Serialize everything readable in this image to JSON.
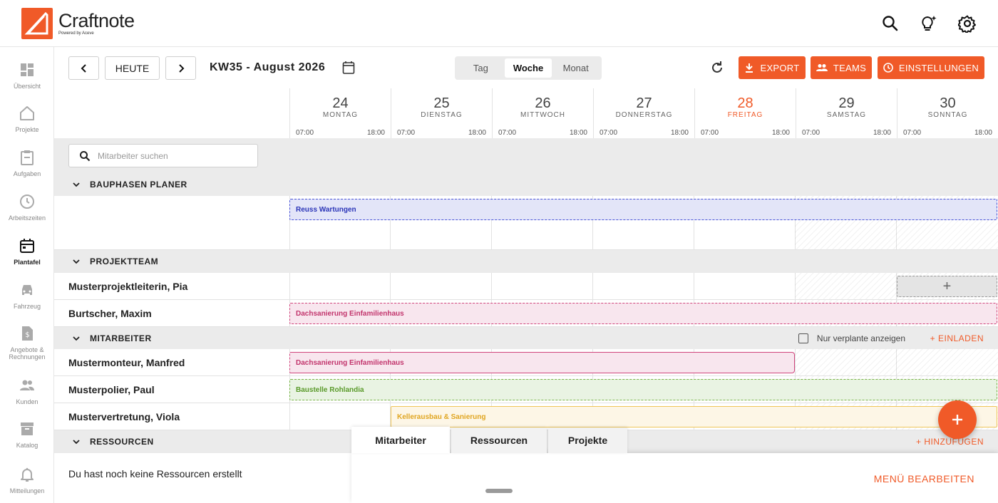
{
  "brand": {
    "name": "Craftnote",
    "sub": "Powered by Aceve",
    "color": "#f05a28"
  },
  "topbar": {
    "icons": [
      "search-icon",
      "lightbulb-icon",
      "gear-icon"
    ]
  },
  "sidebar": {
    "items": [
      {
        "label": "Übersicht",
        "icon": "dashboard-icon"
      },
      {
        "label": "Projekte",
        "icon": "home-icon"
      },
      {
        "label": "Aufgaben",
        "icon": "clipboard-icon"
      },
      {
        "label": "Arbeitszeiten",
        "icon": "clock-icon"
      },
      {
        "label": "Plantafel",
        "icon": "calendar-icon",
        "active": true
      },
      {
        "label": "Fahrzeug",
        "icon": "car-icon"
      },
      {
        "label": "Angebote & Rechnungen",
        "icon": "invoice-icon"
      },
      {
        "label": "Kunden",
        "icon": "people-icon"
      },
      {
        "label": "Katalog",
        "icon": "archive-icon"
      },
      {
        "label": "Mitteilungen",
        "icon": "bell-icon"
      }
    ]
  },
  "toolbar": {
    "today_label": "HEUTE",
    "week_title": "KW35 - August 2026",
    "views": [
      "Tag",
      "Woche",
      "Monat"
    ],
    "active_view": "Woche",
    "export_label": "EXPORT",
    "teams_label": "TEAMS",
    "settings_label": "EINSTELLUNGEN"
  },
  "days": [
    {
      "num": "24",
      "name": "MONTAG",
      "start": "07:00",
      "end": "18:00"
    },
    {
      "num": "25",
      "name": "DIENSTAG",
      "start": "07:00",
      "end": "18:00"
    },
    {
      "num": "26",
      "name": "MITTWOCH",
      "start": "07:00",
      "end": "18:00"
    },
    {
      "num": "27",
      "name": "DONNERSTAG",
      "start": "07:00",
      "end": "18:00"
    },
    {
      "num": "28",
      "name": "FREITAG",
      "start": "07:00",
      "end": "18:00",
      "today": true
    },
    {
      "num": "29",
      "name": "SAMSTAG",
      "start": "07:00",
      "end": "18:00"
    },
    {
      "num": "30",
      "name": "SONNTAG",
      "start": "07:00",
      "end": "18:00"
    }
  ],
  "search": {
    "placeholder": "Mitarbeiter suchen"
  },
  "groups": {
    "bauphasen": "BAUPHASEN PLANER",
    "projektteam": "PROJEKTTEAM",
    "mitarbeiter": "MITARBEITER",
    "ressourcen": "RESSOURCEN"
  },
  "rows": {
    "pia": "Musterprojektleiterin, Pia",
    "maxim": "Burtscher, Maxim",
    "manfred": "Mustermonteur, Manfred",
    "paul": "Musterpolier, Paul",
    "viola": "Mustervertretung, Viola"
  },
  "bars": {
    "reuss": "Reuss Wartungen",
    "dach1": "Dachsanierung Einfamilienhaus",
    "dach2": "Dachsanierung Einfamilienhaus",
    "rohlandia": "Baustelle Rohlandia",
    "keller": "Kellerausbau & Sanierung"
  },
  "mitarbeiter_opts": {
    "only_planned": "Nur verplante anzeigen",
    "invite": "+ EINLADEN"
  },
  "ressourcen": {
    "empty": "Du hast noch keine Ressourcen erstellt",
    "add": "+ HINZUFÜGEN"
  },
  "sheet": {
    "tabs": [
      "Mitarbeiter",
      "Ressourcen",
      "Projekte"
    ],
    "active_tab": "Mitarbeiter",
    "menu_edit": "MENÜ BEARBEITEN"
  }
}
